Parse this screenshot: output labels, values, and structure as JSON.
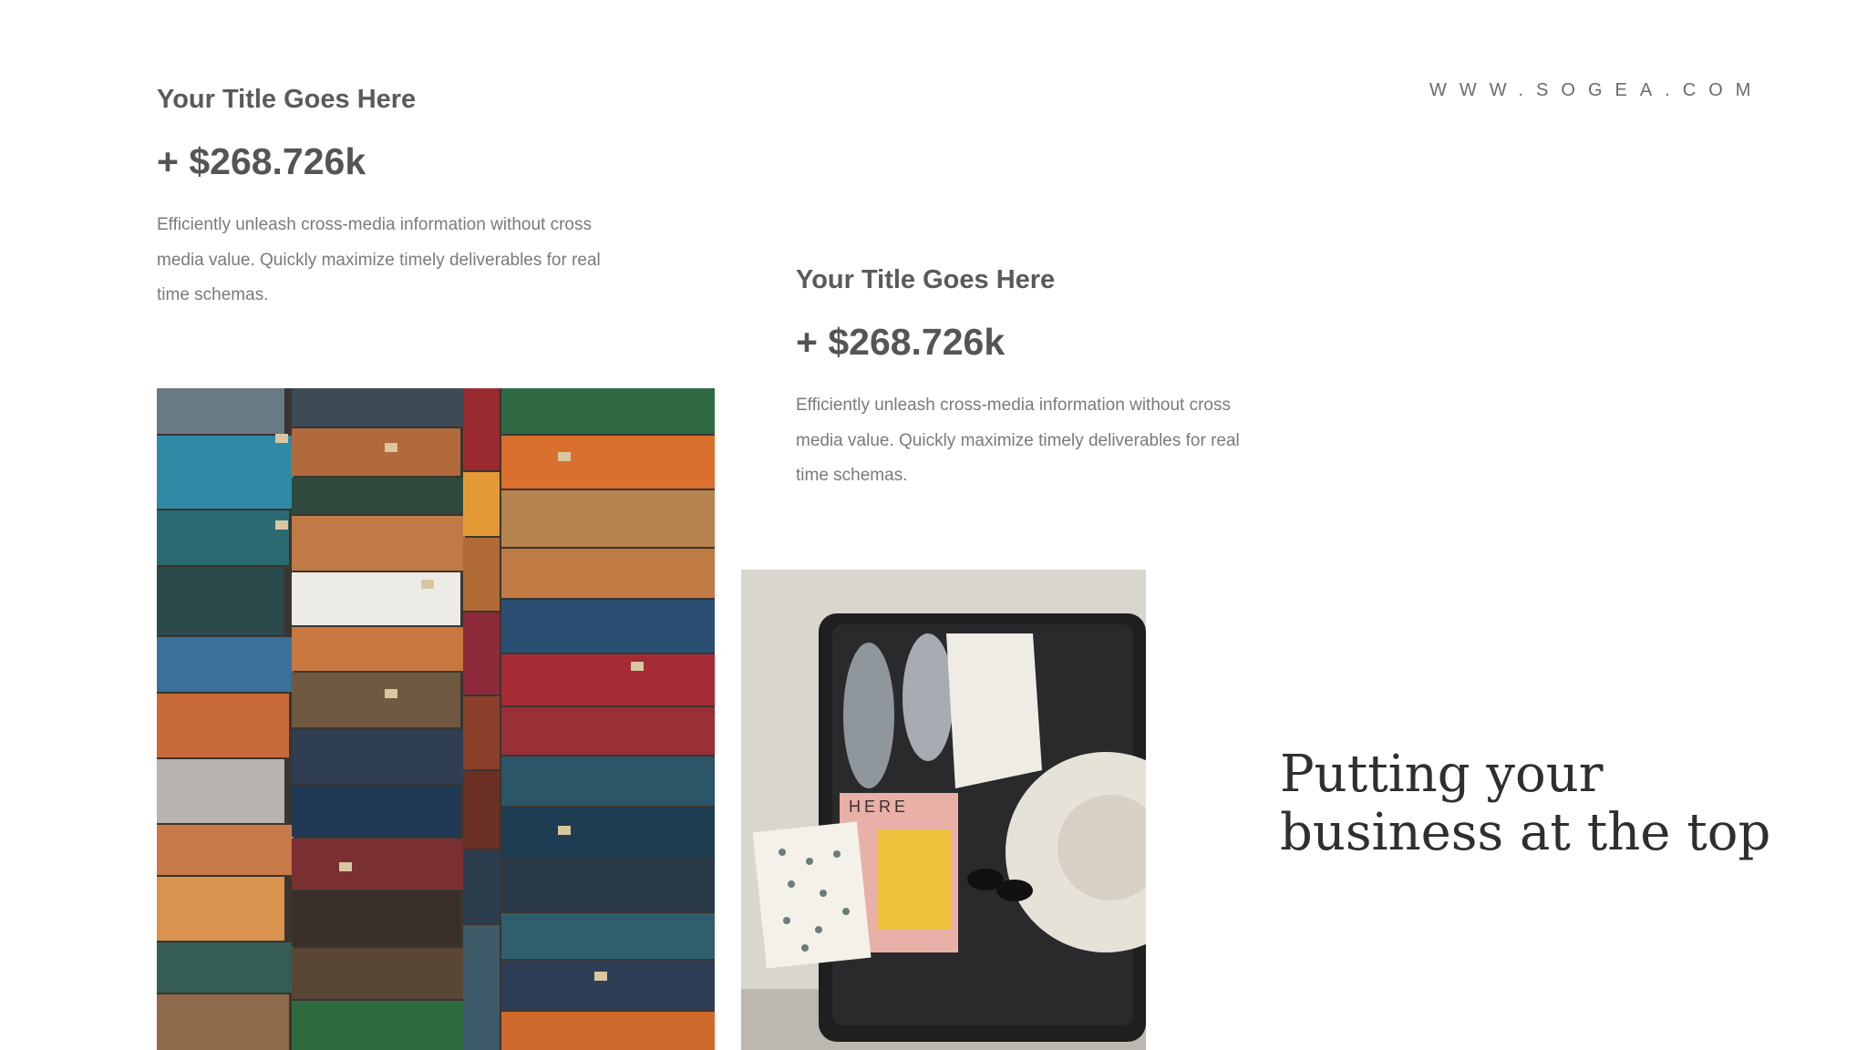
{
  "header": {
    "website": "WWW.SOGEA.COM"
  },
  "blocks": [
    {
      "title": "Your Title Goes Here",
      "value": "+ $268.726k",
      "body": "Efficiently unleash cross-media information without cross media value. Quickly maximize timely deliverables for real time schemas."
    },
    {
      "title": "Your Title Goes Here",
      "value": "+ $268.726k",
      "body": "Efficiently unleash cross-media information without cross media value. Quickly maximize timely deliverables for real time schemas."
    }
  ],
  "headline": {
    "line1": "Putting your",
    "line2": "business at the top"
  },
  "photos": {
    "luggage": "stacked-vintage-suitcases-photo",
    "suitcase": "open-packed-suitcase-photo",
    "suitcase_box_text": "HERE"
  },
  "colors": {
    "text_dark": "#2f2f2f",
    "text_mid": "#555555",
    "text_light": "#7a7a7a",
    "background": "#ffffff"
  }
}
